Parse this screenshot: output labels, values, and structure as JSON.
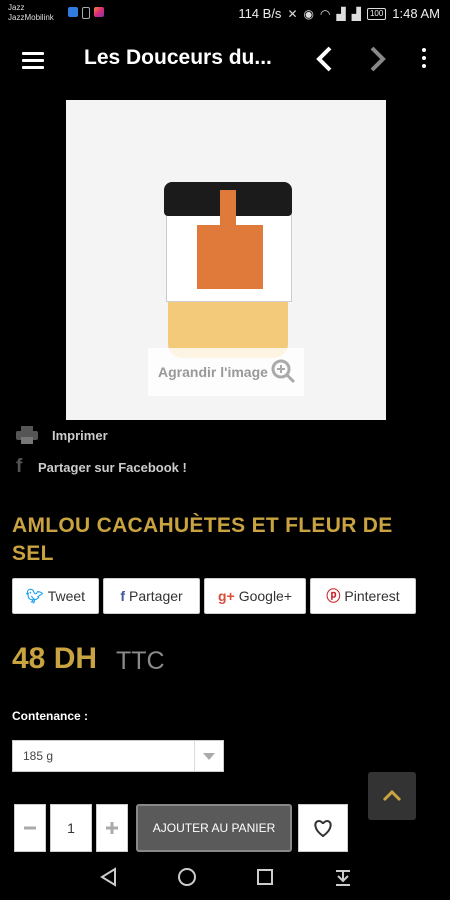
{
  "status_bar": {
    "carrier_line1": "Jazz",
    "carrier_line2": "JazzMobilink",
    "network_speed": "114 B/s",
    "battery": "100",
    "time": "1:48 AM"
  },
  "app_bar": {
    "title": "Les Douceurs du...",
    "icons": [
      "menu-icon",
      "back-icon",
      "forward-icon",
      "more-icon"
    ]
  },
  "product": {
    "image_zoom_label": "Agrandir l'image",
    "print_label": "Imprimer",
    "facebook_share_label": "Partager sur Facebook !",
    "title": "AMLOU CACAHUÈTES ET FLEUR DE SEL",
    "share_buttons": [
      {
        "label": "Tweet",
        "icon": "twitter-icon",
        "color": "#1da1f2"
      },
      {
        "label": "Partager",
        "icon": "facebook-icon",
        "color": "#3b5998"
      },
      {
        "label": "Google+",
        "icon": "google-plus-icon",
        "color": "#dd4b39"
      },
      {
        "label": "Pinterest",
        "icon": "pinterest-icon",
        "color": "#cb2027"
      }
    ],
    "price": "48 DH",
    "tax_label": "TTC",
    "contenance_label": "Contenance :",
    "contenance_value": "185 g",
    "quantity": "1",
    "add_to_cart_label": "AJOUTER AU PANIER"
  },
  "colors": {
    "accent_gold": "#c9a33f",
    "background": "#000000",
    "button_gray": "#5a5a5a"
  }
}
